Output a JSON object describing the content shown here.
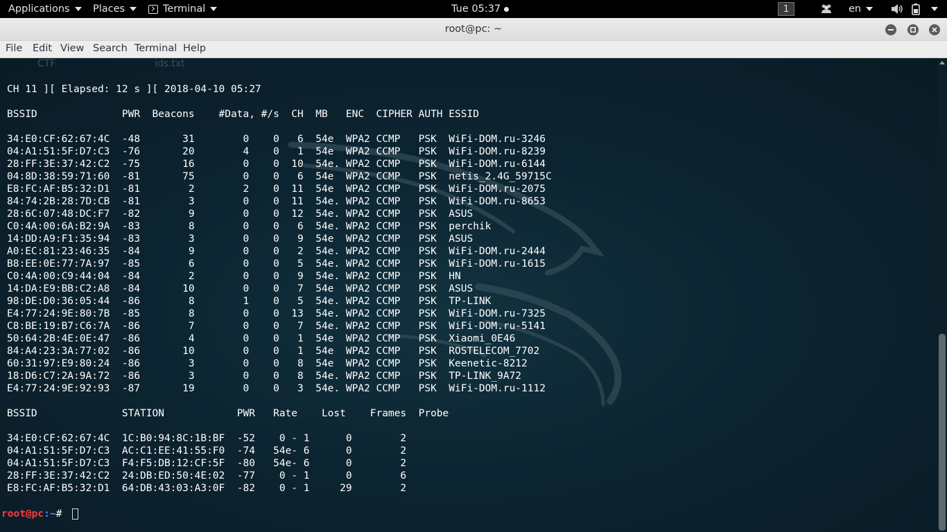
{
  "topbar": {
    "applications": "Applications",
    "places": "Places",
    "terminal": "Terminal",
    "clock": "Tue 05:37",
    "workspace": "1",
    "language": "en",
    "icons": [
      "people-icon",
      "volume-icon",
      "battery-icon",
      "power-menu-icon"
    ]
  },
  "window": {
    "title": "root@pc: ~"
  },
  "menubar": {
    "items": [
      "File",
      "Edit",
      "View",
      "Search",
      "Terminal",
      "Help"
    ]
  },
  "desktop_bg": {
    "label1": "CTF",
    "label2": "ids.txt"
  },
  "terminal": {
    "status_line": "CH 11 ][ Elapsed: 12 s ][ 2018-04-10 05:27",
    "ap_header": "BSSID              PWR  Beacons    #Data, #/s  CH  MB   ENC  CIPHER AUTH ESSID",
    "ap_rows": [
      "34:E0:CF:62:67:4C  -48       31        0    0   6  54e  WPA2 CCMP   PSK  WiFi-DOM.ru-3246",
      "04:A1:51:5F:D7:C3  -76       20        4    0   1  54e  WPA2 CCMP   PSK  WiFi-DOM.ru-8239",
      "28:FF:3E:37:42:C2  -75       16        0    0  10  54e. WPA2 CCMP   PSK  WiFi-DOM.ru-6144",
      "04:8D:38:59:71:60  -81       75        0    0   6  54e  WPA2 CCMP   PSK  netis_2.4G_59715C",
      "E8:FC:AF:B5:32:D1  -81        2        2    0  11  54e  WPA2 CCMP   PSK  WiFi-DOM.ru-2075",
      "84:74:2B:28:7D:CB  -81        3        0    0  11  54e. WPA2 CCMP   PSK  WiFi-DOM.ru-8653",
      "28:6C:07:48:DC:F7  -82        9        0    0  12  54e. WPA2 CCMP   PSK  ASUS",
      "C0:4A:00:6A:B2:9A  -83        8        0    0   6  54e. WPA2 CCMP   PSK  perchik",
      "14:DD:A9:F1:35:94  -83        3        0    0   9  54e  WPA2 CCMP   PSK  ASUS",
      "A0:EC:81:23:46:35  -84        9        0    0   2  54e. WPA2 CCMP   PSK  WiFi-DOM.ru-2444",
      "B8:EE:0E:77:7A:97  -85        6        0    0   5  54e. WPA2 CCMP   PSK  WiFi-DOM.ru-1615",
      "C0:4A:00:C9:44:04  -84        2        0    0   9  54e. WPA2 CCMP   PSK  HN",
      "14:DA:E9:BB:C2:A8  -84       10        0    0   7  54e  WPA2 CCMP   PSK  ASUS",
      "98:DE:D0:36:05:44  -86        8        1    0   5  54e. WPA2 CCMP   PSK  TP-LINK",
      "E4:77:24:9E:80:7B  -85        8        0    0  13  54e. WPA2 CCMP   PSK  WiFi-DOM.ru-7325",
      "C8:BE:19:B7:C6:7A  -86        7        0    0   7  54e. WPA2 CCMP   PSK  WiFi-DOM.ru-5141",
      "50:64:2B:4E:0E:47  -86        4        0    0   1  54e  WPA2 CCMP   PSK  Xiaomi_0E46",
      "84:A4:23:3A:77:02  -86       10        0    0   1  54e  WPA2 CCMP   PSK  ROSTELECOM_7702",
      "60:31:97:E9:80:24  -86        3        0    0   8  54e  WPA2 CCMP   PSK  Keenetic-8212",
      "18:D6:C7:2A:9A:72  -86        3        0    0   8  54e. WPA2 CCMP   PSK  TP-LINK_9A72",
      "E4:77:24:9E:92:93  -87       19        0    0   3  54e. WPA2 CCMP   PSK  WiFi-DOM.ru-1112"
    ],
    "station_header": "BSSID              STATION            PWR   Rate    Lost    Frames  Probe",
    "station_rows": [
      "34:E0:CF:62:67:4C  1C:B0:94:8C:1B:BF  -52    0 - 1      0        2",
      "04:A1:51:5F:D7:C3  AC:C1:EE:41:55:F0  -74   54e- 6      0        2",
      "04:A1:51:5F:D7:C3  F4:F5:DB:12:CF:5F  -80   54e- 6      0        2",
      "28:FF:3E:37:42:C2  24:DB:ED:50:4E:02  -77    0 - 1      0        6",
      "E8:FC:AF:B5:32:D1  64:DB:43:03:A3:0F  -82    0 - 1     29        2"
    ],
    "prompt": {
      "user_host": "root@pc",
      "path": ":~",
      "symbol": "# "
    }
  }
}
